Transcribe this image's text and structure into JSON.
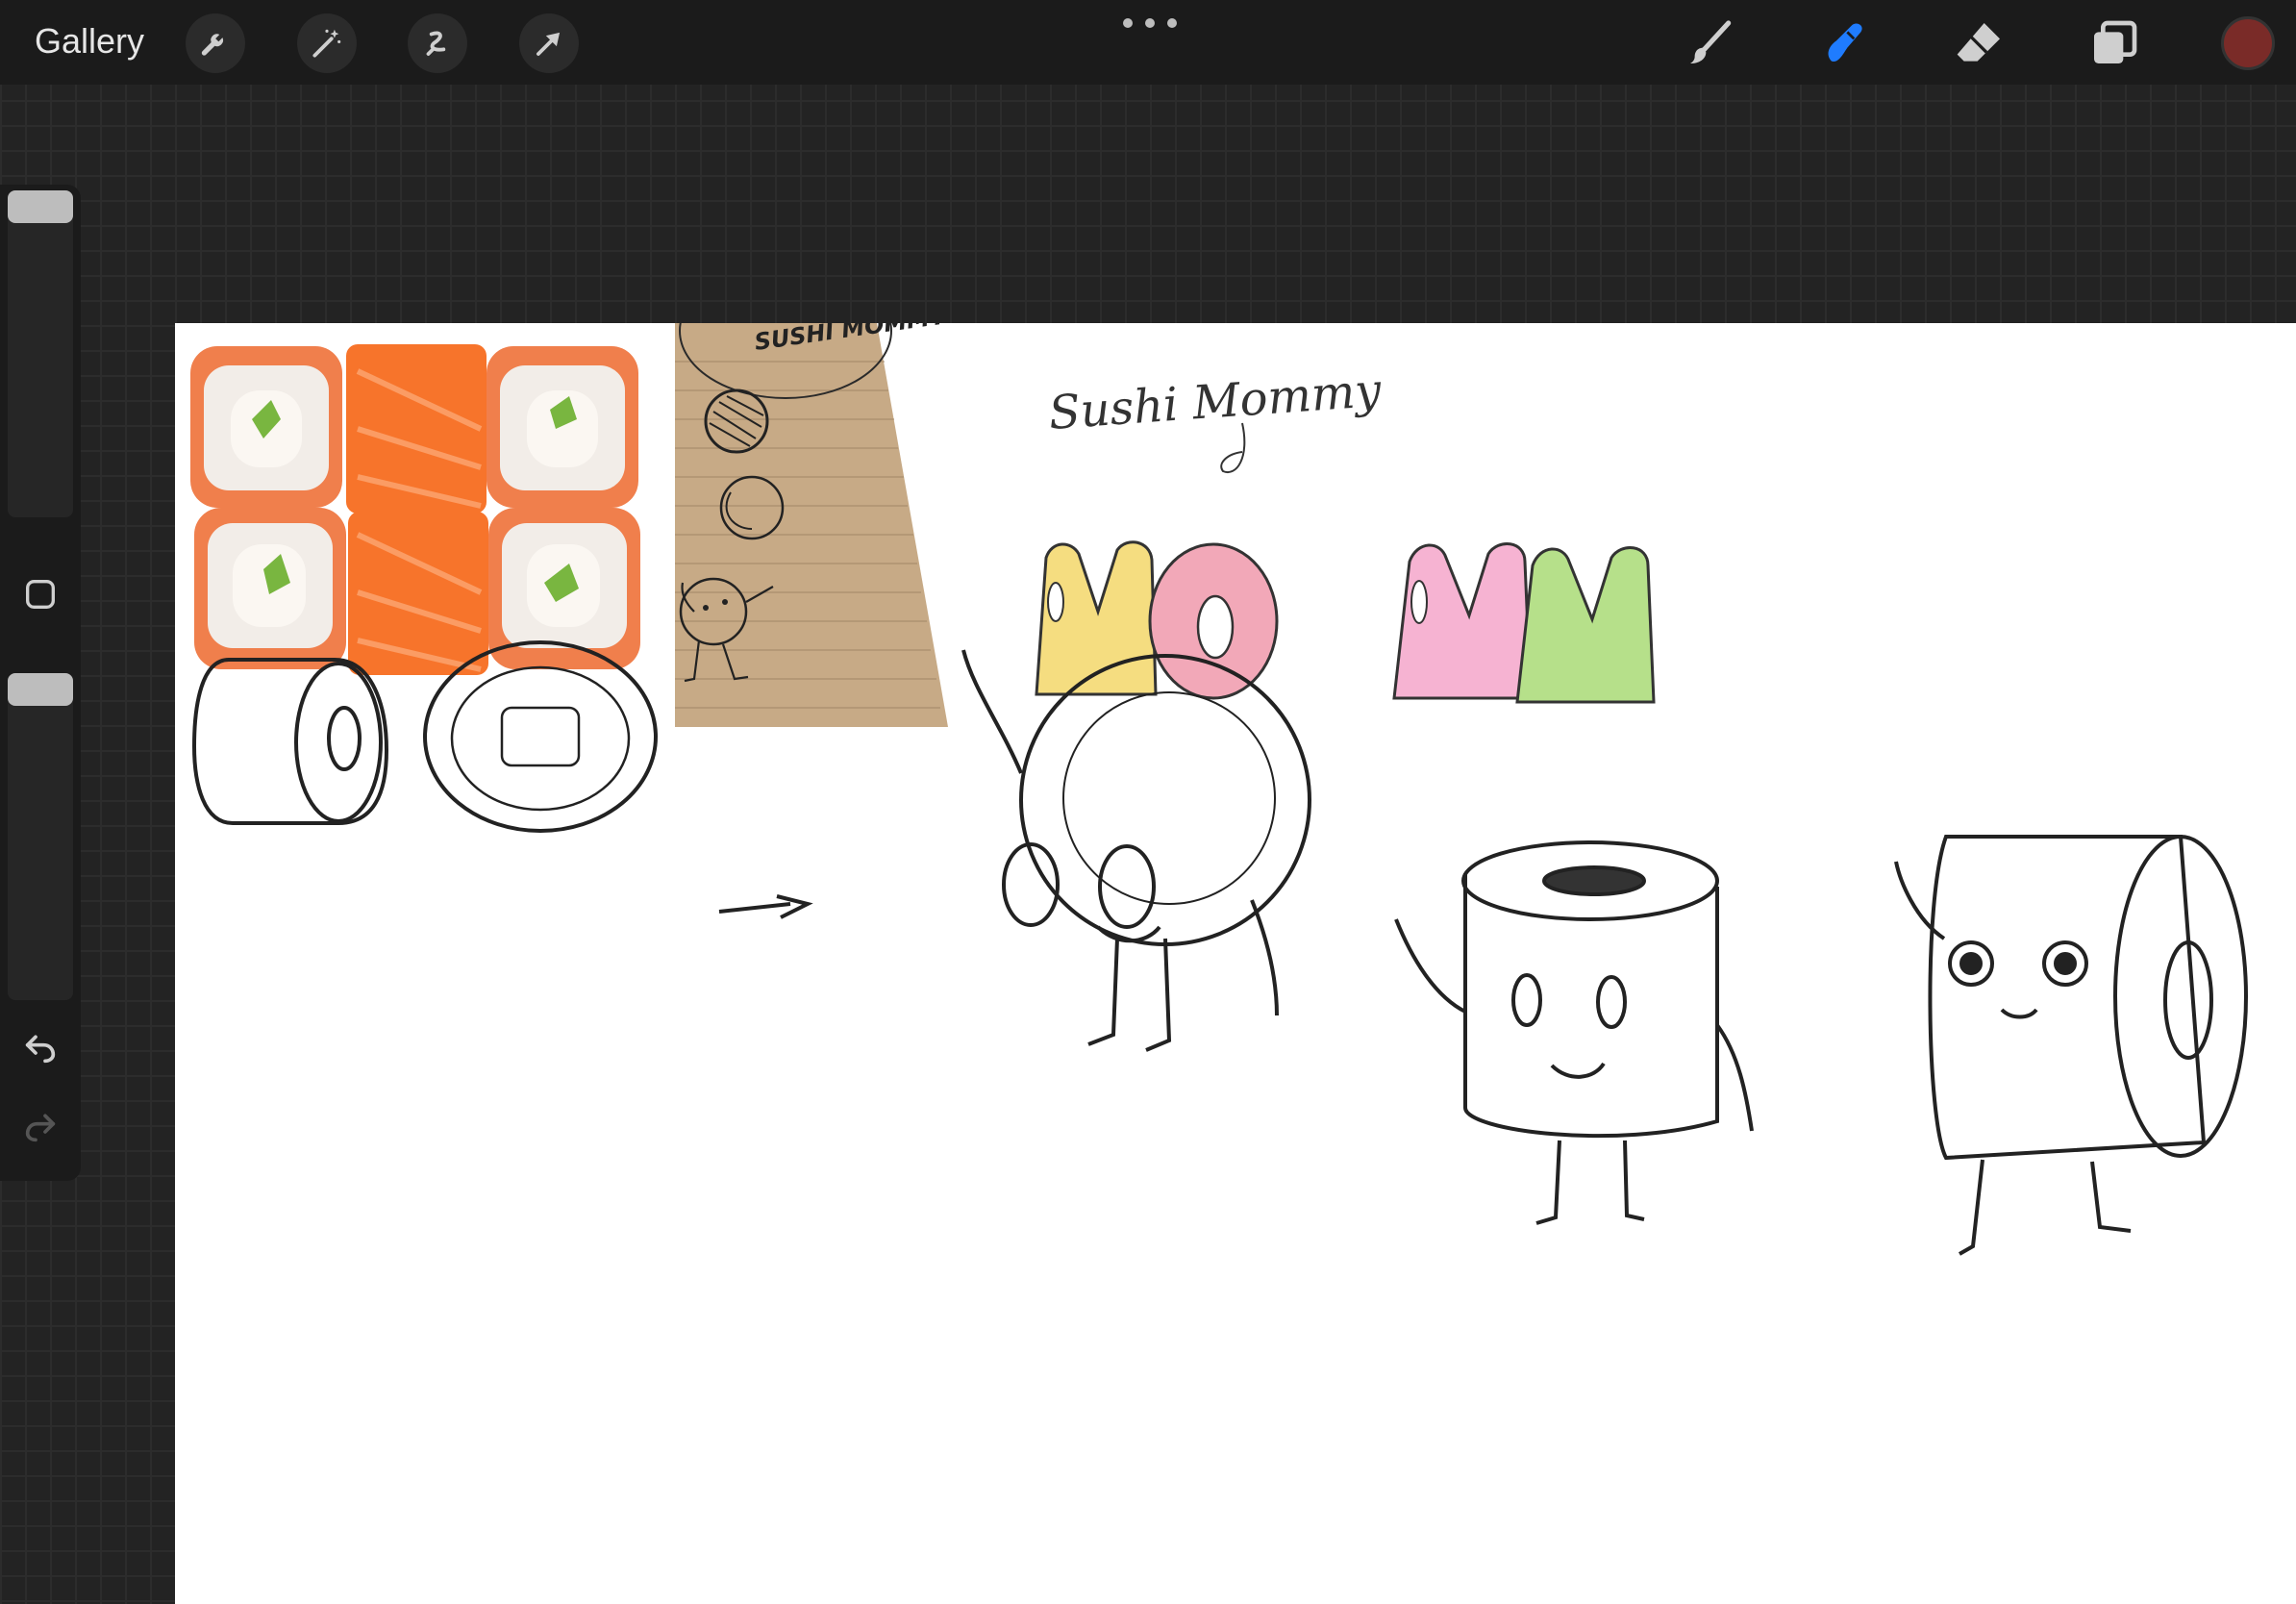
{
  "topbar": {
    "gallery_label": "Gallery",
    "left_tools": [
      {
        "name": "wrench-icon",
        "label": "Actions"
      },
      {
        "name": "magic-wand-icon",
        "label": "Adjustments"
      },
      {
        "name": "selection-icon",
        "label": "Selection"
      },
      {
        "name": "transform-arrow-icon",
        "label": "Transform"
      }
    ],
    "right_tools": [
      {
        "name": "brush-icon",
        "active": false
      },
      {
        "name": "smudge-icon",
        "active": true
      },
      {
        "name": "eraser-icon",
        "active": false
      },
      {
        "name": "layers-icon",
        "active": false
      }
    ],
    "current_color": "#7a2b28",
    "accent_color": "#1f7cff"
  },
  "sidebar": {
    "brush_size_level": 0.0,
    "opacity_level": 0.0,
    "tools": [
      "square-modify-icon",
      "undo-icon",
      "redo-icon"
    ]
  },
  "canvas": {
    "handwritten_title": "Sushi Mommy",
    "notebook_text": "SUSHI MOMMY",
    "letter_sketches": [
      {
        "text": "MO",
        "colors": [
          "#f5dd80",
          "#f2a8b8"
        ]
      },
      {
        "text": "MM",
        "colors": [
          "#f6b3d2",
          "#b6e08a"
        ]
      }
    ]
  }
}
